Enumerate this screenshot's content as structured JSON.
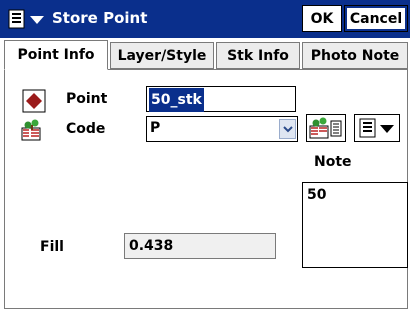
{
  "title": "Store Point",
  "buttons": {
    "ok": "OK",
    "cancel": "Cancel"
  },
  "tabs": [
    "Point Info",
    "Layer/Style",
    "Stk Info",
    "Photo Note"
  ],
  "active_tab": "Point Info",
  "form": {
    "point_label": "Point",
    "point_value": "50_stk",
    "code_label": "Code",
    "code_value": "P",
    "note_label": "Note",
    "note_value": "50",
    "fill_label": "Fill",
    "fill_value": "0.438"
  },
  "colors": {
    "titlebar": "#0a2f8c",
    "point_marker": "#9b1b1b"
  },
  "icons": [
    "menu-icon",
    "point-marker-icon",
    "code-library-icon",
    "chevron-down-icon",
    "library-list-icon",
    "dropdown-menu-icon"
  ]
}
